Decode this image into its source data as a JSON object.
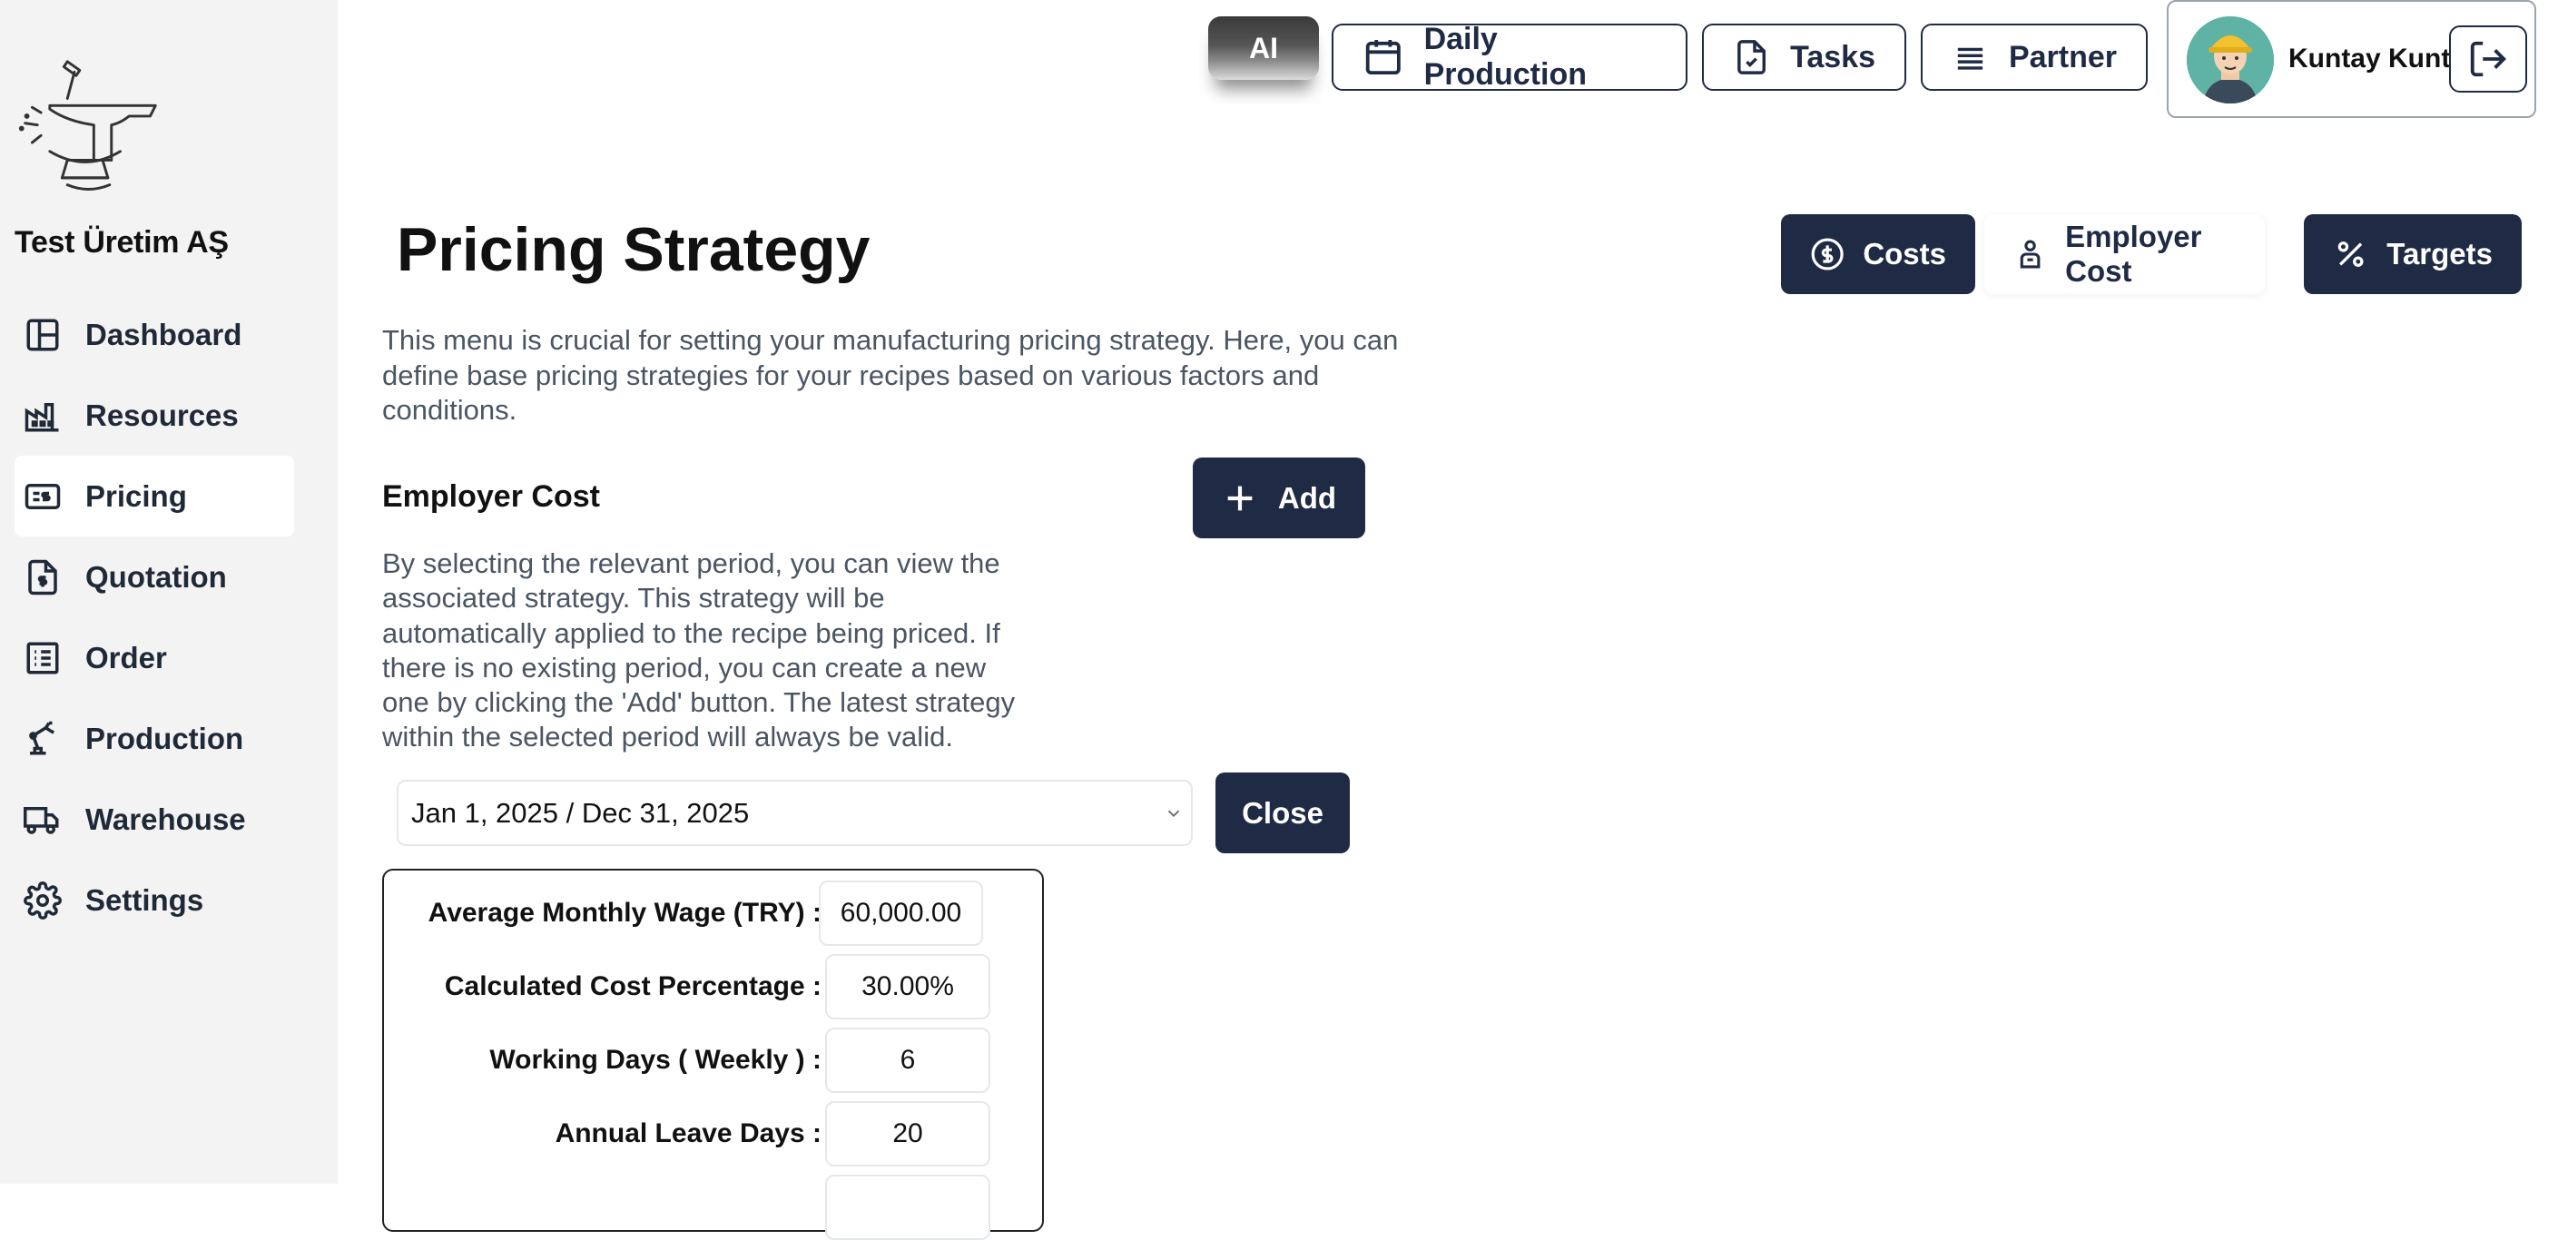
{
  "company": {
    "name": "Test Üretim AŞ"
  },
  "sidebar": {
    "items": [
      {
        "label": "Dashboard",
        "icon": "dashboard-icon",
        "active": false
      },
      {
        "label": "Resources",
        "icon": "factory-icon",
        "active": false
      },
      {
        "label": "Pricing",
        "icon": "price-tag-icon",
        "active": true
      },
      {
        "label": "Quotation",
        "icon": "quotation-icon",
        "active": false
      },
      {
        "label": "Order",
        "icon": "order-list-icon",
        "active": false
      },
      {
        "label": "Production",
        "icon": "robot-arm-icon",
        "active": false
      },
      {
        "label": "Warehouse",
        "icon": "truck-icon",
        "active": false
      },
      {
        "label": "Settings",
        "icon": "gear-icon",
        "active": false
      }
    ]
  },
  "topbar": {
    "ai_label": "AI",
    "daily_production_label": "Daily Production",
    "tasks_label": "Tasks",
    "partner_label": "Partner",
    "user_name": "Kuntay Kunt"
  },
  "page": {
    "title": "Pricing Strategy",
    "intro": "This menu is crucial for setting your manufacturing pricing strategy. Here, you can define base pricing strategies for your recipes based on various factors and conditions.",
    "tabs": [
      {
        "label": "Costs",
        "icon": "dollar-circle-icon",
        "style": "dark"
      },
      {
        "label": "Employer Cost",
        "icon": "employee-icon",
        "style": "light"
      },
      {
        "label": "Targets",
        "icon": "percent-icon",
        "style": "dark"
      }
    ]
  },
  "employer_cost": {
    "title": "Employer Cost",
    "add_label": "Add",
    "description": "By selecting the relevant period, you can view the associated strategy. This strategy will be automatically applied to the recipe being priced. If there is no existing period, you can create a new one by clicking the 'Add' button. The latest strategy within the selected period will always be valid.",
    "period_selected": "Jan 1, 2025 / Dec 31, 2025",
    "close_label": "Close",
    "fields": [
      {
        "label": "Average Monthly Wage (TRY) :",
        "value": "60,000.00"
      },
      {
        "label": "Calculated Cost Percentage  :",
        "value": "30.00%"
      },
      {
        "label": "Working Days ( Weekly )  :",
        "value": "6"
      },
      {
        "label": "Annual Leave Days :",
        "value": "20"
      },
      {
        "label": "",
        "value": ""
      }
    ]
  },
  "colors": {
    "primary": "#1f2a44",
    "sidebar_bg": "#f3f3f3"
  }
}
